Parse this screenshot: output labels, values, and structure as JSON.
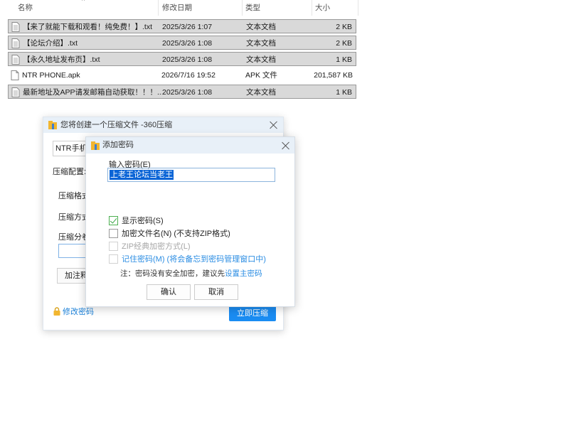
{
  "explorer": {
    "columns": {
      "name": "名称",
      "date": "修改日期",
      "type": "类型",
      "size": "大小"
    },
    "files": [
      {
        "name": "【来了就能下载和观看！纯免费！】.txt",
        "date": "2025/3/26 1:07",
        "type": "文本文档",
        "size": "2 KB",
        "selected": true
      },
      {
        "name": "【论坛介绍】.txt",
        "date": "2025/3/26 1:08",
        "type": "文本文档",
        "size": "2 KB",
        "selected": true
      },
      {
        "name": "【永久地址发布页】.txt",
        "date": "2025/3/26 1:08",
        "type": "文本文档",
        "size": "1 KB",
        "selected": true
      },
      {
        "name": "NTR PHONE.apk",
        "date": "2026/7/16 19:52",
        "type": "APK 文件",
        "size": "201,587 KB",
        "selected": false
      },
      {
        "name": "最新地址及APP请发邮箱自动获取！！！....",
        "date": "2025/3/26 1:08",
        "type": "文本文档",
        "size": "1 KB",
        "selected": true
      }
    ]
  },
  "compress_dialog": {
    "title": "您将创建一个压缩文件 -360压缩",
    "filename_prefix": "NTR手机",
    "config_label": "压缩配置:",
    "format_label": "压缩格式",
    "method_label": "压缩方式",
    "split_label": "压缩分卷",
    "comment_button": "加注释",
    "change_password_link": "修改密码",
    "compress_now_button": "立即压缩"
  },
  "password_dialog": {
    "title": "添加密码",
    "input_label": "输入密码(E)",
    "password_value": "上老王论坛当老王",
    "options": {
      "show_password": "显示密码(S)",
      "encrypt_filenames": "加密文件名(N) (不支持ZIP格式)",
      "zip_classic": "ZIP经典加密方式(L)",
      "remember_password": "记住密码(M) (将会备忘到密码管理窗口中)"
    },
    "note_prefix": "注：密码没有安全加密，建议先",
    "note_link": "设置主密码",
    "ok_button": "确认",
    "cancel_button": "取消"
  },
  "colors": {
    "accent": "#1a8cf2",
    "link": "#2b8de3",
    "selection": "#0a64d6",
    "row_selected": "#d9d9d9"
  }
}
